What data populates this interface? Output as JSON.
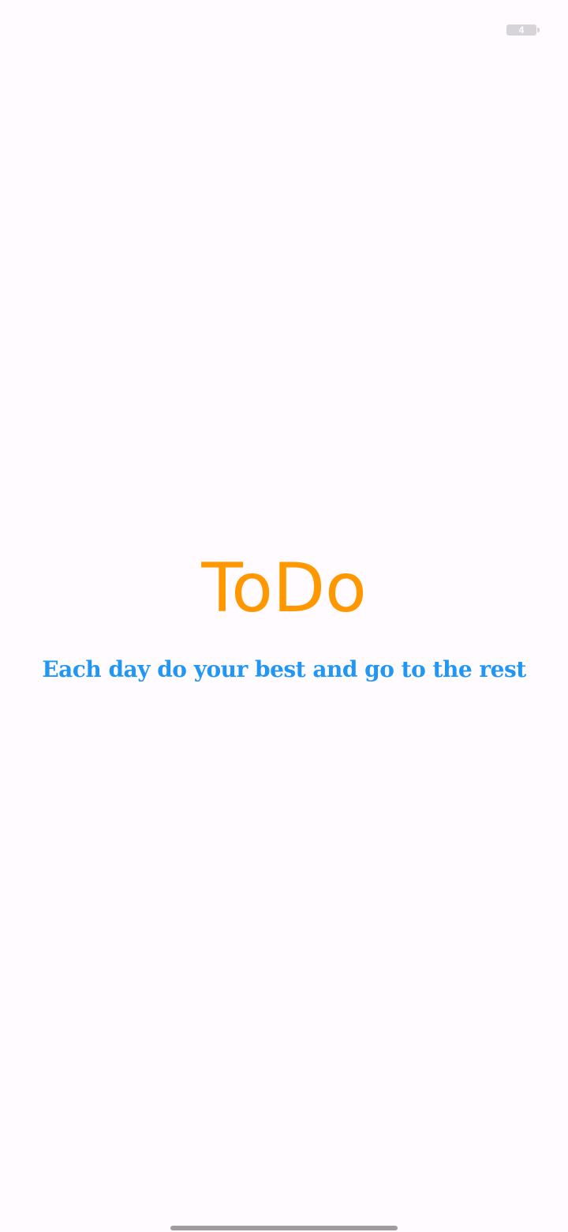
{
  "status_bar": {
    "time": "",
    "battery_level": "4",
    "text_color": "#ffffff",
    "battery_color": "#d6d4d8"
  },
  "splash": {
    "title": "ToDo",
    "tagline": "Each day do your best and go to the rest",
    "title_color": "#ff9800",
    "tagline_color": "#2196f3",
    "background_color": "#fffbfe"
  },
  "navigation": {
    "home_indicator_color": "#9e9ca0"
  }
}
